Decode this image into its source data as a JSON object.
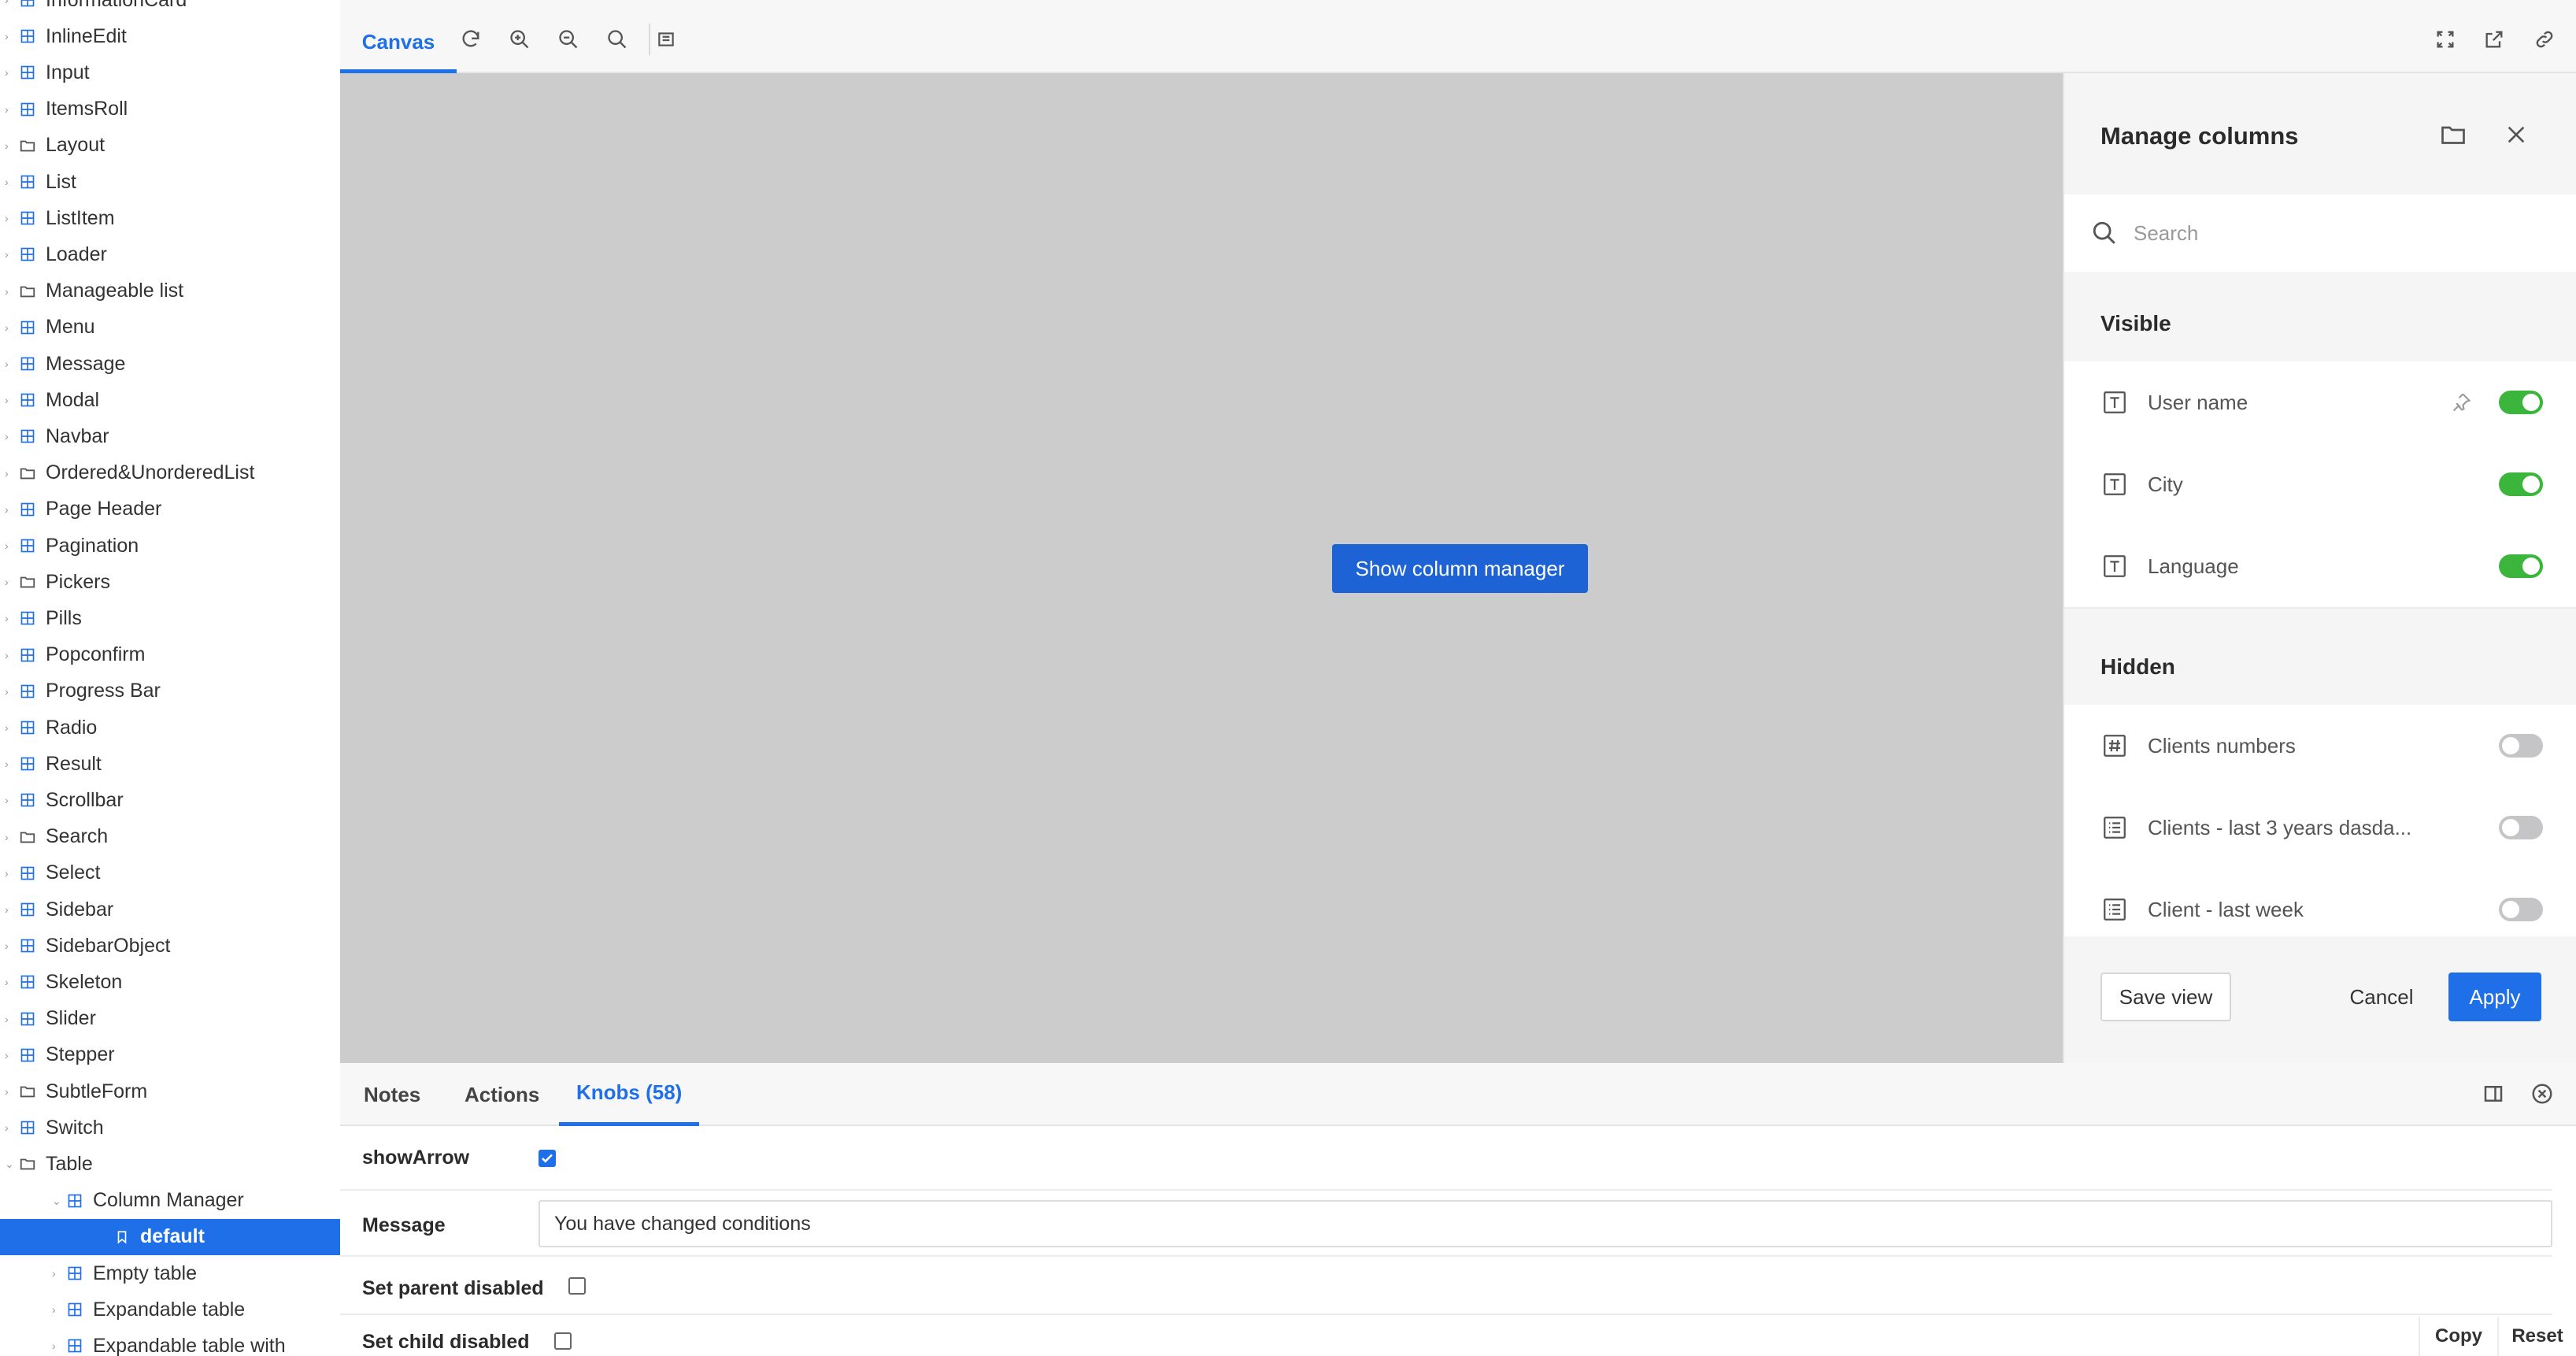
{
  "sidebar": {
    "items": [
      {
        "label": "InformationCard",
        "type": "component"
      },
      {
        "label": "InlineEdit",
        "type": "component"
      },
      {
        "label": "Input",
        "type": "component"
      },
      {
        "label": "ItemsRoll",
        "type": "component"
      },
      {
        "label": "Layout",
        "type": "folder"
      },
      {
        "label": "List",
        "type": "component"
      },
      {
        "label": "ListItem",
        "type": "component"
      },
      {
        "label": "Loader",
        "type": "component"
      },
      {
        "label": "Manageable list",
        "type": "folder"
      },
      {
        "label": "Menu",
        "type": "component"
      },
      {
        "label": "Message",
        "type": "component"
      },
      {
        "label": "Modal",
        "type": "component"
      },
      {
        "label": "Navbar",
        "type": "component"
      },
      {
        "label": "Ordered&UnorderedList",
        "type": "folder"
      },
      {
        "label": "Page Header",
        "type": "component"
      },
      {
        "label": "Pagination",
        "type": "component"
      },
      {
        "label": "Pickers",
        "type": "folder"
      },
      {
        "label": "Pills",
        "type": "component"
      },
      {
        "label": "Popconfirm",
        "type": "component"
      },
      {
        "label": "Progress Bar",
        "type": "component"
      },
      {
        "label": "Radio",
        "type": "component"
      },
      {
        "label": "Result",
        "type": "component"
      },
      {
        "label": "Scrollbar",
        "type": "component"
      },
      {
        "label": "Search",
        "type": "folder"
      },
      {
        "label": "Select",
        "type": "component"
      },
      {
        "label": "Sidebar",
        "type": "component"
      },
      {
        "label": "SidebarObject",
        "type": "component"
      },
      {
        "label": "Skeleton",
        "type": "component"
      },
      {
        "label": "Slider",
        "type": "component"
      },
      {
        "label": "Stepper",
        "type": "component"
      },
      {
        "label": "SubtleForm",
        "type": "folder"
      },
      {
        "label": "Switch",
        "type": "component"
      },
      {
        "label": "Table",
        "type": "folder-open"
      },
      {
        "label": "Column Manager",
        "type": "component"
      },
      {
        "label": "default",
        "type": "story"
      },
      {
        "label": "Empty table",
        "type": "component"
      },
      {
        "label": "Expandable table",
        "type": "component"
      },
      {
        "label": "Expandable table with",
        "type": "component"
      }
    ]
  },
  "toolbar": {
    "canvas_tab": "Canvas",
    "icons": [
      "refresh-icon",
      "zoom-in-icon",
      "zoom-out-icon",
      "zoom-reset-icon",
      "background-icon"
    ],
    "right_icons": [
      "fullscreen-icon",
      "open-new-tab-icon",
      "copy-link-icon"
    ]
  },
  "canvas": {
    "show_button": "Show column manager",
    "background": "#cccccc"
  },
  "column_manager": {
    "title": "Manage columns",
    "search_placeholder": "Search",
    "visible_label": "Visible",
    "hidden_label": "Hidden",
    "visible_columns": [
      {
        "label": "User name",
        "icon": "text-type-icon",
        "pinned": true,
        "enabled": true
      },
      {
        "label": "City",
        "icon": "text-type-icon",
        "pinned": false,
        "enabled": true
      },
      {
        "label": "Language",
        "icon": "text-type-icon",
        "pinned": false,
        "enabled": true
      }
    ],
    "hidden_columns": [
      {
        "label": "Clients numbers",
        "icon": "number-type-icon",
        "enabled": false
      },
      {
        "label": "Clients - last 3 years dasda...",
        "icon": "list-type-icon",
        "enabled": false
      },
      {
        "label": "Client - last week",
        "icon": "list-type-icon",
        "enabled": false
      }
    ],
    "save_view": "Save view",
    "cancel": "Cancel",
    "apply": "Apply"
  },
  "addons": {
    "tabs": [
      "Notes",
      "Actions",
      "Knobs (58)"
    ],
    "active_tab": "Knobs (58)",
    "knobs": {
      "show_arrow_label": "showArrow",
      "show_arrow_checked": true,
      "message_label": "Message",
      "message_value": "You have changed conditions",
      "set_parent_disabled_label": "Set parent disabled",
      "set_child_disabled_label": "Set child disabled"
    },
    "copy": "Copy",
    "reset": "Reset"
  },
  "colors": {
    "accent": "#1e6fe8",
    "toggle_on": "#3bb53b",
    "toggle_off": "#c5c5c8"
  }
}
